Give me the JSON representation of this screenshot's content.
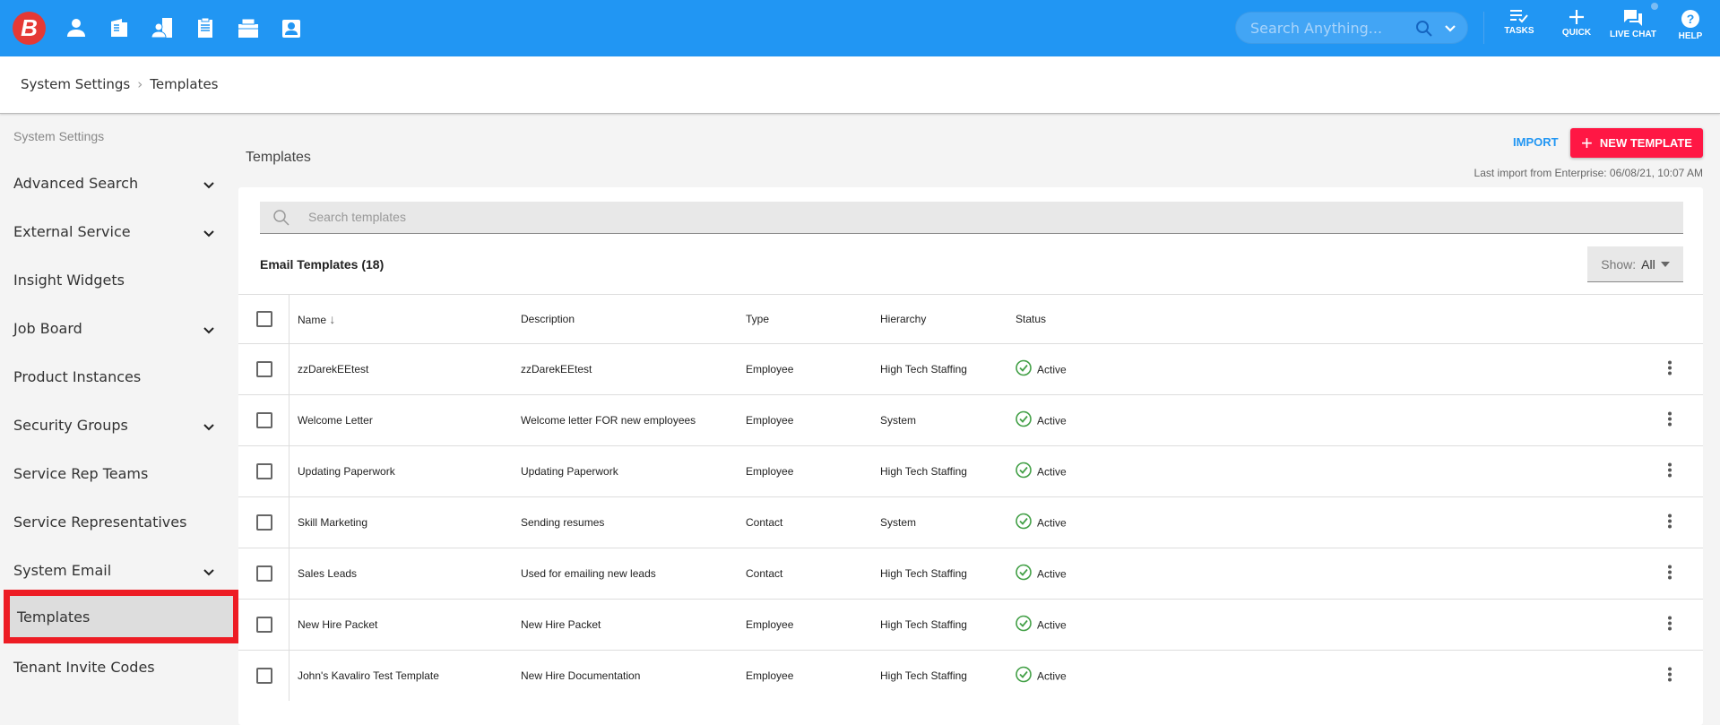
{
  "header": {
    "logo": "B",
    "nav_icons": [
      "candidate-icon",
      "company-icon",
      "contact-icon",
      "job-order-icon",
      "placement-icon",
      "contact-card-icon"
    ],
    "search_placeholder": "Search Anything...",
    "tools": [
      {
        "label": "TASKS",
        "icon": "tasks-icon"
      },
      {
        "label": "QUICK",
        "icon": "plus-icon"
      },
      {
        "label": "LIVE CHAT",
        "icon": "chat-icon"
      },
      {
        "label": "HELP",
        "icon": "help-icon"
      }
    ]
  },
  "breadcrumb": {
    "parent": "System Settings",
    "current": "Templates"
  },
  "sidebar": {
    "title": "System Settings",
    "items": [
      {
        "label": "Advanced Search",
        "expandable": true
      },
      {
        "label": "External Service",
        "expandable": true
      },
      {
        "label": "Insight Widgets",
        "expandable": false
      },
      {
        "label": "Job Board",
        "expandable": true
      },
      {
        "label": "Product Instances",
        "expandable": false
      },
      {
        "label": "Security Groups",
        "expandable": true
      },
      {
        "label": "Service Rep Teams",
        "expandable": false
      },
      {
        "label": "Service Representatives",
        "expandable": false
      },
      {
        "label": "System Email",
        "expandable": true
      },
      {
        "label": "Templates",
        "expandable": false,
        "active": true
      },
      {
        "label": "Tenant Invite Codes",
        "expandable": false
      }
    ]
  },
  "main": {
    "title": "Templates",
    "import_label": "IMPORT",
    "new_label": "NEW TEMPLATE",
    "last_import": "Last import from Enterprise: 06/08/21, 10:07 AM",
    "search_placeholder": "Search templates",
    "count_label": "Email Templates (18)",
    "show_label": "Show:",
    "show_value": "All",
    "columns": [
      "Name",
      "Description",
      "Type",
      "Hierarchy",
      "Status"
    ],
    "rows": [
      [
        "zzDarekEEtest",
        "zzDarekEEtest",
        "Employee",
        "High Tech Staffing",
        "Active"
      ],
      [
        "Welcome Letter",
        "Welcome letter FOR new employees",
        "Employee",
        "System",
        "Active"
      ],
      [
        "Updating Paperwork",
        "Updating Paperwork",
        "Employee",
        "High Tech Staffing",
        "Active"
      ],
      [
        "Skill Marketing",
        "Sending resumes",
        "Contact",
        "System",
        "Active"
      ],
      [
        "Sales Leads",
        "Used for emailing new leads",
        "Contact",
        "High Tech Staffing",
        "Active"
      ],
      [
        "New Hire Packet",
        "New Hire Packet",
        "Employee",
        "High Tech Staffing",
        "Active"
      ],
      [
        "John's Kavaliro Test Template",
        "New Hire Documentation",
        "Employee",
        "High Tech Staffing",
        "Active"
      ]
    ]
  },
  "colors": {
    "brand": "#2196f3",
    "accent": "#ff1744",
    "active": "#4caf50",
    "highlight": "#ed1c24"
  }
}
